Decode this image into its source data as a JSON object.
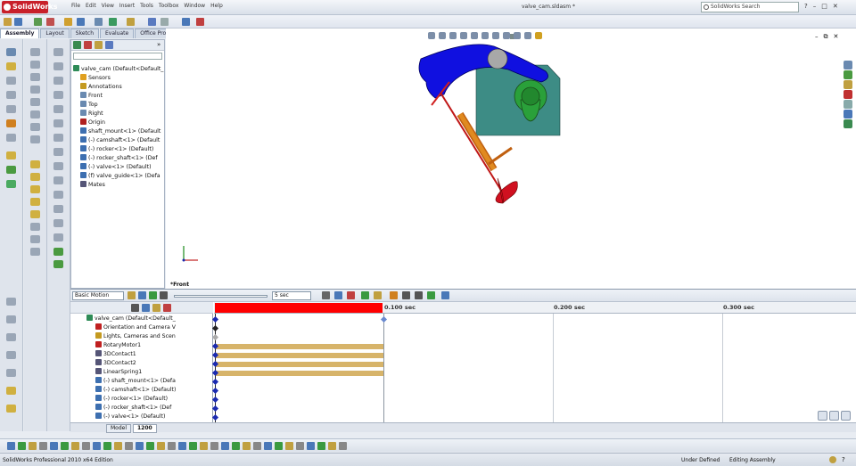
{
  "app": {
    "name": "SolidWorks",
    "document_title": "valve_cam.sldasm *"
  },
  "menus": [
    "File",
    "Edit",
    "View",
    "Insert",
    "Tools",
    "Toolbox",
    "Window",
    "Help"
  ],
  "search": {
    "placeholder": "SolidWorks Search"
  },
  "command_tabs": [
    "Assembly",
    "Layout",
    "Sketch",
    "Evaluate",
    "Office Products"
  ],
  "feature_tree": [
    {
      "label": "valve_cam  (Default<Default_",
      "icon": "assembly-icon",
      "color": "#2e8b57",
      "indent": 0
    },
    {
      "label": "Sensors",
      "icon": "sensor-icon",
      "color": "#e0a020",
      "indent": 1
    },
    {
      "label": "Annotations",
      "icon": "annotation-icon",
      "color": "#c49a20",
      "indent": 1
    },
    {
      "label": "Front",
      "icon": "plane-icon",
      "color": "#6a8ab0",
      "indent": 1
    },
    {
      "label": "Top",
      "icon": "plane-icon",
      "color": "#6a8ab0",
      "indent": 1
    },
    {
      "label": "Right",
      "icon": "plane-icon",
      "color": "#6a8ab0",
      "indent": 1
    },
    {
      "label": "Origin",
      "icon": "origin-icon",
      "color": "#b02020",
      "indent": 1
    },
    {
      "label": "shaft_mount<1> (Default",
      "icon": "part-icon",
      "color": "#3d6fb0",
      "indent": 1
    },
    {
      "label": "(-) camshaft<1> (Default",
      "icon": "part-icon",
      "color": "#3d6fb0",
      "indent": 1
    },
    {
      "label": "(-) rocker<1> (Default)",
      "icon": "part-icon",
      "color": "#3d6fb0",
      "indent": 1
    },
    {
      "label": "(-) rocker_shaft<1> (Def",
      "icon": "part-icon",
      "color": "#3d6fb0",
      "indent": 1
    },
    {
      "label": "(-) valve<1> (Default)",
      "icon": "part-icon",
      "color": "#3d6fb0",
      "indent": 1
    },
    {
      "label": "(f) valve_guide<1> (Defa",
      "icon": "part-icon",
      "color": "#3d6fb0",
      "indent": 1
    },
    {
      "label": "Mates",
      "icon": "mates-icon",
      "color": "#557",
      "indent": 1
    }
  ],
  "viewport": {
    "orientation_label": "*Front"
  },
  "motion": {
    "study_type": "Basic Motion",
    "duration": "5 sec",
    "time_labels": [
      "0.100 sec",
      "0.200 sec",
      "0.300 sec"
    ],
    "tree": [
      {
        "label": "valve_cam  (Default<Default_",
        "color": "#2e8b57",
        "indent": 0
      },
      {
        "label": "Orientation and Camera V",
        "color": "#c02020",
        "indent": 1
      },
      {
        "label": "Lights, Cameras and Scen",
        "color": "#c49a20",
        "indent": 1
      },
      {
        "label": "RotaryMotor1",
        "color": "#c02020",
        "indent": 1
      },
      {
        "label": "3DContact1",
        "color": "#557",
        "indent": 1
      },
      {
        "label": "3DContact2",
        "color": "#557",
        "indent": 1
      },
      {
        "label": "LinearSpring1",
        "color": "#557",
        "indent": 1
      },
      {
        "label": "(-) shaft_mount<1> (Defa",
        "color": "#3d6fb0",
        "indent": 1
      },
      {
        "label": "(-) camshaft<1> (Default)",
        "color": "#3d6fb0",
        "indent": 1
      },
      {
        "label": "(-) rocker<1> (Default)",
        "color": "#3d6fb0",
        "indent": 1
      },
      {
        "label": "(-) rocker_shaft<1> (Def",
        "color": "#3d6fb0",
        "indent": 1
      },
      {
        "label": "(-) valve<1> (Default)",
        "color": "#3d6fb0",
        "indent": 1
      }
    ],
    "tabs": [
      "Model",
      "1200"
    ]
  },
  "status": {
    "edition": "SolidWorks Professional 2010 x64 Edition",
    "state": "Under Defined",
    "mode": "Editing Assembly"
  }
}
